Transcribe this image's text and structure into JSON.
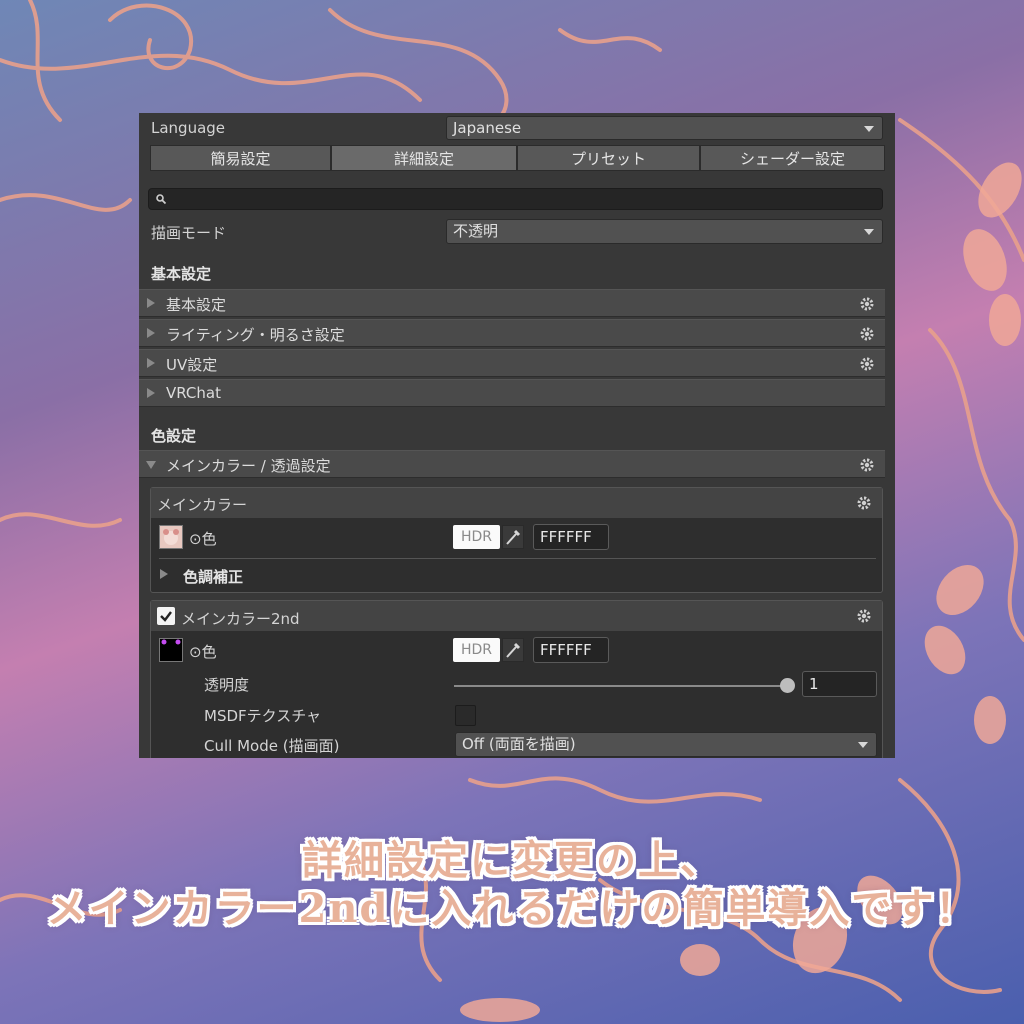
{
  "language": {
    "label": "Language",
    "value": "Japanese"
  },
  "tabs": [
    "簡易設定",
    "詳細設定",
    "プリセット",
    "シェーダー設定"
  ],
  "render_mode": {
    "label": "描画モード",
    "value": "不透明"
  },
  "basic_section": {
    "title": "基本設定",
    "items": [
      "基本設定",
      "ライティング・明るさ設定",
      "UV設定",
      "VRChat"
    ]
  },
  "color_section": {
    "title": "色設定",
    "expanded_item": "メインカラー / 透過設定",
    "main_color": {
      "title": "メインカラー",
      "color_label": "⊙色",
      "hdr": "HDR",
      "hex": "FFFFFF",
      "sub_fold": "色調補正"
    },
    "main_color_2nd": {
      "title": "メインカラー2nd",
      "checked": true,
      "color_label": "⊙色",
      "hdr": "HDR",
      "hex": "FFFFFF",
      "opacity_label": "透明度",
      "opacity_value": "1",
      "msdf_label": "MSDFテクスチャ",
      "cull_label": "Cull Mode (描画面)",
      "cull_value": "Off (両面を描画)"
    }
  },
  "caption": {
    "line1": "詳細設定に変更の上、",
    "line2": "メインカラー2ndに入れるだけの簡単導入です！"
  }
}
